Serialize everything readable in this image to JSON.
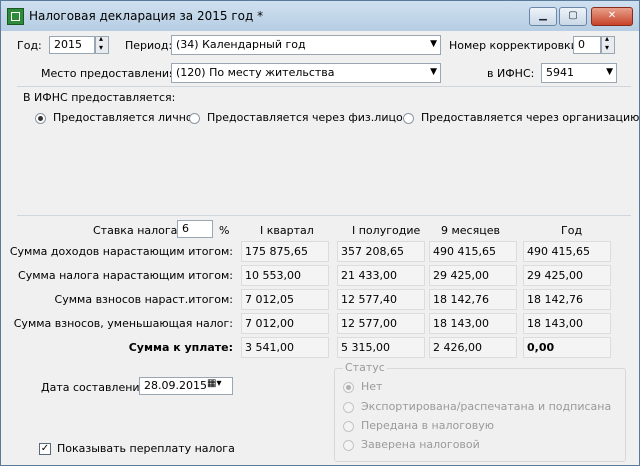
{
  "window": {
    "title": "Налоговая декларация за 2015 год *"
  },
  "header": {
    "year_label": "Год:",
    "year_value": "2015",
    "period_label": "Период:",
    "period_value": "(34) Календарный год",
    "correction_label": "Номер корректировки:",
    "correction_value": "0",
    "place_label": "Место предоставления:",
    "place_value": "(120) По месту жительства",
    "ifns_label": "в ИФНС:",
    "ifns_value": "5941"
  },
  "provision": {
    "label": "В ИФНС предоставляется:",
    "options": [
      "Предоставляется лично",
      "Предоставляется через физ.лицо",
      "Предоставляется через организацию"
    ],
    "selected": 0
  },
  "table": {
    "rate_label": "Ставка налога:",
    "rate_value": "6",
    "rate_unit": "%",
    "columns": [
      "I квартал",
      "I полугодие",
      "9 месяцев",
      "Год"
    ],
    "rows": [
      {
        "label": "Сумма доходов нарастающим итогом:",
        "values": [
          "175 875,65",
          "357 208,65",
          "490 415,65",
          "490 415,65"
        ]
      },
      {
        "label": "Сумма налога нарастающим итогом:",
        "values": [
          "10 553,00",
          "21 433,00",
          "29 425,00",
          "29 425,00"
        ]
      },
      {
        "label": "Сумма взносов нараст.итогом:",
        "values": [
          "7 012,05",
          "12 577,40",
          "18 142,76",
          "18 142,76"
        ]
      },
      {
        "label": "Сумма взносов, уменьшающая налог:",
        "values": [
          "7 012,00",
          "12 577,00",
          "18 143,00",
          "18 143,00"
        ]
      },
      {
        "label": "Сумма к уплате:",
        "values": [
          "3 541,00",
          "5 315,00",
          "2 426,00",
          "0,00"
        ]
      }
    ]
  },
  "footer": {
    "date_label": "Дата составления:",
    "date_value": "28.09.2015",
    "overpay_label": "Показывать переплату налога",
    "overpay_checked": true
  },
  "status": {
    "label": "Статус",
    "options": [
      "Нет",
      "Экспортирована/распечатана и подписана",
      "Передана в налоговую",
      "Заверена налоговой"
    ],
    "selected": 0
  }
}
